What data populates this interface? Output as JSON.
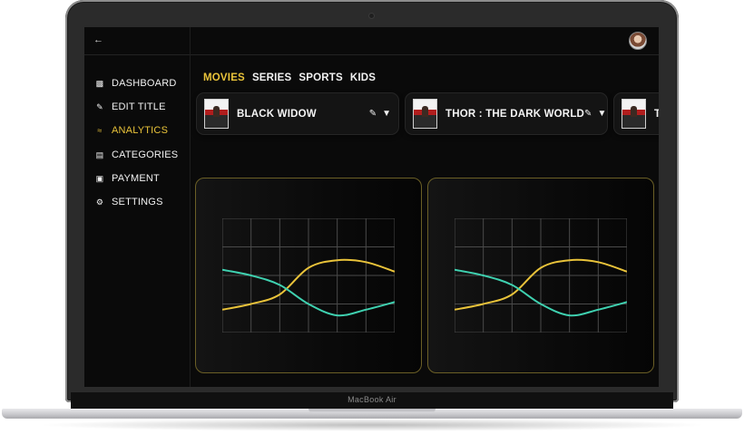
{
  "device": {
    "label": "MacBook Air"
  },
  "nav": {
    "back_icon": "arrow-left-icon",
    "items": [
      {
        "label": "DASHBOARD",
        "icon": "dashboard-icon"
      },
      {
        "label": "EDIT TITLE",
        "icon": "pencil-icon"
      },
      {
        "label": "ANALYTICS",
        "icon": "analytics-icon",
        "active": true
      },
      {
        "label": "CATEGORIES",
        "icon": "categories-icon"
      },
      {
        "label": "PAYMENT",
        "icon": "payment-icon"
      },
      {
        "label": "SETTINGS",
        "icon": "gear-icon"
      }
    ]
  },
  "tabs": [
    {
      "label": "MOVIES",
      "active": true
    },
    {
      "label": "SERIES"
    },
    {
      "label": "SPORTS"
    },
    {
      "label": "KIDS"
    }
  ],
  "titles": [
    {
      "name": "BLACK WIDOW"
    },
    {
      "name": "THOR : THE DARK WORLD"
    },
    {
      "name": "TH"
    }
  ],
  "colors": {
    "accent": "#e9c33a",
    "series_yellow": "#e9c33a",
    "series_teal": "#3fd1b0",
    "background": "#0a0a0a"
  },
  "chart_data": [
    {
      "type": "line",
      "x": [
        0,
        1,
        2,
        3,
        4,
        5,
        6
      ],
      "ylim": [
        0,
        6
      ],
      "grid": true,
      "series": [
        {
          "values": [
            1.2,
            1.5,
            2.0,
            3.4,
            3.8,
            3.7,
            3.2
          ]
        },
        {
          "values": [
            3.3,
            3.0,
            2.5,
            1.5,
            0.9,
            1.2,
            1.6
          ]
        }
      ]
    },
    {
      "type": "line",
      "x": [
        0,
        1,
        2,
        3,
        4,
        5,
        6
      ],
      "ylim": [
        0,
        6
      ],
      "grid": true,
      "series": [
        {
          "values": [
            1.2,
            1.5,
            2.0,
            3.4,
            3.8,
            3.7,
            3.2
          ]
        },
        {
          "values": [
            3.3,
            3.0,
            2.5,
            1.5,
            0.9,
            1.2,
            1.6
          ]
        }
      ]
    }
  ]
}
